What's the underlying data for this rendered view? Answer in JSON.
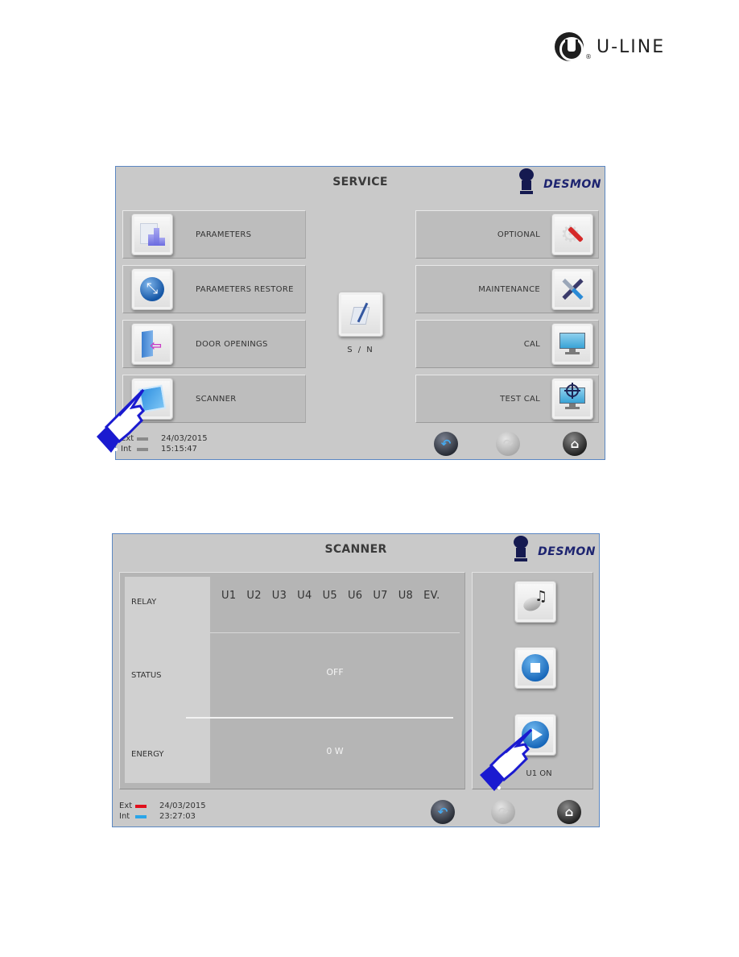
{
  "brand": {
    "name": "U-LINE",
    "registered_mark": "®"
  },
  "screen1": {
    "title": "SERVICE",
    "logo_text": "DESMON",
    "left_buttons": [
      {
        "label": "PARAMETERS",
        "icon": "chart-icon"
      },
      {
        "label": "PARAMETERS RESTORE",
        "icon": "restore-globe-icon"
      },
      {
        "label": "DOOR OPENINGS",
        "icon": "door-icon"
      },
      {
        "label": "SCANNER",
        "icon": "scanner-icon"
      }
    ],
    "center_button": {
      "label": "S / N",
      "icon": "serial-number-icon"
    },
    "right_buttons": [
      {
        "label": "OPTIONAL",
        "icon": "gear-screwdriver-icon"
      },
      {
        "label": "MAINTENANCE",
        "icon": "tools-icon"
      },
      {
        "label": "CAL",
        "icon": "monitor-icon"
      },
      {
        "label": "TEST CAL",
        "icon": "monitor-target-icon"
      }
    ],
    "footer": {
      "date": "24/03/2015",
      "time": "15:15:47",
      "ext_label": "Ext",
      "int_label": "Int",
      "ext_color": "#8a8a8a",
      "int_color": "#8a8a8a"
    },
    "nav": {
      "back": "back-icon",
      "forward": "forward-icon",
      "home": "home-icon"
    }
  },
  "screen2": {
    "title": "SCANNER",
    "logo_text": "DESMON",
    "rows": {
      "relay_label": "RELAY",
      "status_label": "STATUS",
      "energy_label": "ENERGY"
    },
    "relays": [
      "U1",
      "U2",
      "U3",
      "U4",
      "U5",
      "U6",
      "U7",
      "U8",
      "EV."
    ],
    "status_value": "OFF",
    "energy_value": "0 W",
    "side_buttons": {
      "sound": "sound-icon",
      "stop": "stop-icon",
      "play": "play-icon",
      "caption": "U1 ON"
    },
    "footer": {
      "date": "24/03/2015",
      "time": "23:27:03",
      "ext_label": "Ext",
      "int_label": "Int",
      "ext_color": "#e0101c",
      "int_color": "#2aa5e8"
    }
  }
}
